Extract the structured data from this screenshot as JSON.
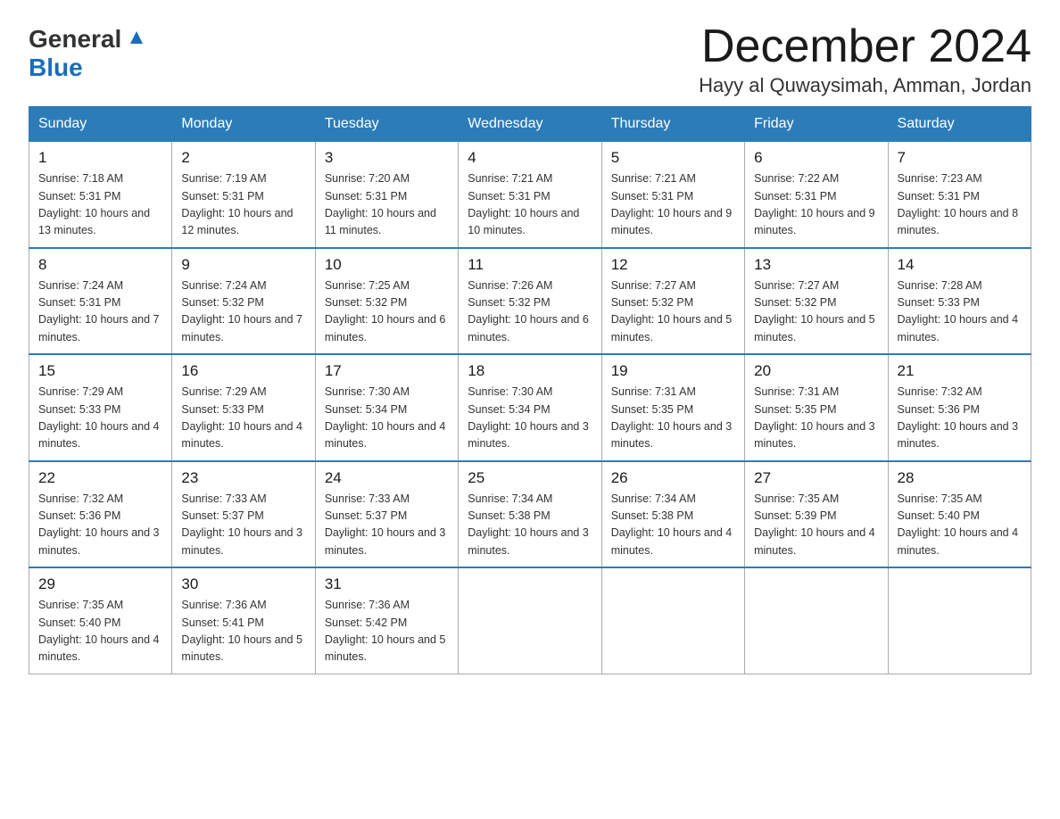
{
  "header": {
    "logo_general": "General",
    "logo_blue": "Blue",
    "month_title": "December 2024",
    "location": "Hayy al Quwaysimah, Amman, Jordan"
  },
  "days_of_week": [
    "Sunday",
    "Monday",
    "Tuesday",
    "Wednesday",
    "Thursday",
    "Friday",
    "Saturday"
  ],
  "weeks": [
    [
      {
        "day": "1",
        "sunrise": "7:18 AM",
        "sunset": "5:31 PM",
        "daylight": "10 hours and 13 minutes."
      },
      {
        "day": "2",
        "sunrise": "7:19 AM",
        "sunset": "5:31 PM",
        "daylight": "10 hours and 12 minutes."
      },
      {
        "day": "3",
        "sunrise": "7:20 AM",
        "sunset": "5:31 PM",
        "daylight": "10 hours and 11 minutes."
      },
      {
        "day": "4",
        "sunrise": "7:21 AM",
        "sunset": "5:31 PM",
        "daylight": "10 hours and 10 minutes."
      },
      {
        "day": "5",
        "sunrise": "7:21 AM",
        "sunset": "5:31 PM",
        "daylight": "10 hours and 9 minutes."
      },
      {
        "day": "6",
        "sunrise": "7:22 AM",
        "sunset": "5:31 PM",
        "daylight": "10 hours and 9 minutes."
      },
      {
        "day": "7",
        "sunrise": "7:23 AM",
        "sunset": "5:31 PM",
        "daylight": "10 hours and 8 minutes."
      }
    ],
    [
      {
        "day": "8",
        "sunrise": "7:24 AM",
        "sunset": "5:31 PM",
        "daylight": "10 hours and 7 minutes."
      },
      {
        "day": "9",
        "sunrise": "7:24 AM",
        "sunset": "5:32 PM",
        "daylight": "10 hours and 7 minutes."
      },
      {
        "day": "10",
        "sunrise": "7:25 AM",
        "sunset": "5:32 PM",
        "daylight": "10 hours and 6 minutes."
      },
      {
        "day": "11",
        "sunrise": "7:26 AM",
        "sunset": "5:32 PM",
        "daylight": "10 hours and 6 minutes."
      },
      {
        "day": "12",
        "sunrise": "7:27 AM",
        "sunset": "5:32 PM",
        "daylight": "10 hours and 5 minutes."
      },
      {
        "day": "13",
        "sunrise": "7:27 AM",
        "sunset": "5:32 PM",
        "daylight": "10 hours and 5 minutes."
      },
      {
        "day": "14",
        "sunrise": "7:28 AM",
        "sunset": "5:33 PM",
        "daylight": "10 hours and 4 minutes."
      }
    ],
    [
      {
        "day": "15",
        "sunrise": "7:29 AM",
        "sunset": "5:33 PM",
        "daylight": "10 hours and 4 minutes."
      },
      {
        "day": "16",
        "sunrise": "7:29 AM",
        "sunset": "5:33 PM",
        "daylight": "10 hours and 4 minutes."
      },
      {
        "day": "17",
        "sunrise": "7:30 AM",
        "sunset": "5:34 PM",
        "daylight": "10 hours and 4 minutes."
      },
      {
        "day": "18",
        "sunrise": "7:30 AM",
        "sunset": "5:34 PM",
        "daylight": "10 hours and 3 minutes."
      },
      {
        "day": "19",
        "sunrise": "7:31 AM",
        "sunset": "5:35 PM",
        "daylight": "10 hours and 3 minutes."
      },
      {
        "day": "20",
        "sunrise": "7:31 AM",
        "sunset": "5:35 PM",
        "daylight": "10 hours and 3 minutes."
      },
      {
        "day": "21",
        "sunrise": "7:32 AM",
        "sunset": "5:36 PM",
        "daylight": "10 hours and 3 minutes."
      }
    ],
    [
      {
        "day": "22",
        "sunrise": "7:32 AM",
        "sunset": "5:36 PM",
        "daylight": "10 hours and 3 minutes."
      },
      {
        "day": "23",
        "sunrise": "7:33 AM",
        "sunset": "5:37 PM",
        "daylight": "10 hours and 3 minutes."
      },
      {
        "day": "24",
        "sunrise": "7:33 AM",
        "sunset": "5:37 PM",
        "daylight": "10 hours and 3 minutes."
      },
      {
        "day": "25",
        "sunrise": "7:34 AM",
        "sunset": "5:38 PM",
        "daylight": "10 hours and 3 minutes."
      },
      {
        "day": "26",
        "sunrise": "7:34 AM",
        "sunset": "5:38 PM",
        "daylight": "10 hours and 4 minutes."
      },
      {
        "day": "27",
        "sunrise": "7:35 AM",
        "sunset": "5:39 PM",
        "daylight": "10 hours and 4 minutes."
      },
      {
        "day": "28",
        "sunrise": "7:35 AM",
        "sunset": "5:40 PM",
        "daylight": "10 hours and 4 minutes."
      }
    ],
    [
      {
        "day": "29",
        "sunrise": "7:35 AM",
        "sunset": "5:40 PM",
        "daylight": "10 hours and 4 minutes."
      },
      {
        "day": "30",
        "sunrise": "7:36 AM",
        "sunset": "5:41 PM",
        "daylight": "10 hours and 5 minutes."
      },
      {
        "day": "31",
        "sunrise": "7:36 AM",
        "sunset": "5:42 PM",
        "daylight": "10 hours and 5 minutes."
      },
      null,
      null,
      null,
      null
    ]
  ],
  "labels": {
    "sunrise": "Sunrise:",
    "sunset": "Sunset:",
    "daylight": "Daylight:"
  }
}
